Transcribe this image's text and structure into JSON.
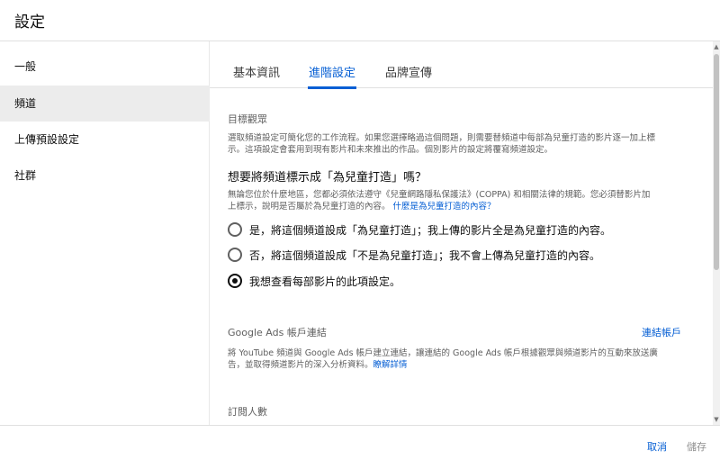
{
  "dialog": {
    "title": "設定"
  },
  "sidebar": {
    "items": [
      {
        "label": "一般"
      },
      {
        "label": "頻道"
      },
      {
        "label": "上傳預設設定"
      },
      {
        "label": "社群"
      }
    ]
  },
  "tabs": [
    {
      "label": "基本資訊"
    },
    {
      "label": "進階設定"
    },
    {
      "label": "品牌宣傳"
    }
  ],
  "audience": {
    "heading": "目標觀眾",
    "description_lines": [
      "選取頻道設定可簡化您的工作流程。如果您選擇略過這個問題，則需要替頻道中每部為兒童打造的影片逐一加上標",
      "示。這項設定會套用到現有影片和未來推出的作品。個別影片的設定將覆寫頻道設定。"
    ],
    "question": "想要將頻道標示成「為兒童打造」嗎？",
    "help_lines": [
      "無論您位於什麼地區，您都必須依法遵守《兒童網路隱私保護法》(COPPA) 和相關法律的規範。您必須替影片加",
      "上標示，說明是否屬於為兒童打造的內容。"
    ],
    "help_link": "什麼是為兒童打造的內容？",
    "options": [
      {
        "label": "是，將這個頻道設成「為兒童打造」；我上傳的影片全是為兒童打造的內容。",
        "checked": false
      },
      {
        "label": "否，將這個頻道設成「不是為兒童打造」；我不會上傳為兒童打造的內容。",
        "checked": false
      },
      {
        "label": "我想查看每部影片的此項設定。",
        "checked": true
      }
    ]
  },
  "google_ads": {
    "heading": "Google Ads 帳戶連結",
    "link_account": "連結帳戶",
    "description_lines": [
      "將 YouTube 頻道與 Google Ads 帳戶建立連結，讓連結的 Google Ads 帳戶根據觀眾與頻道影片的互動來放送廣",
      "告，並取得頻道影片的深入分析資料。"
    ],
    "learn_more": "瞭解詳情"
  },
  "subscribers": {
    "heading": "訂閱人數"
  },
  "footer": {
    "cancel": "取消",
    "save": "儲存"
  },
  "scrollbar": {
    "up": "▲",
    "down": "▼"
  },
  "colors": {
    "accent": "#065fd4",
    "active_bg": "#ececec",
    "muted": "#606060"
  }
}
